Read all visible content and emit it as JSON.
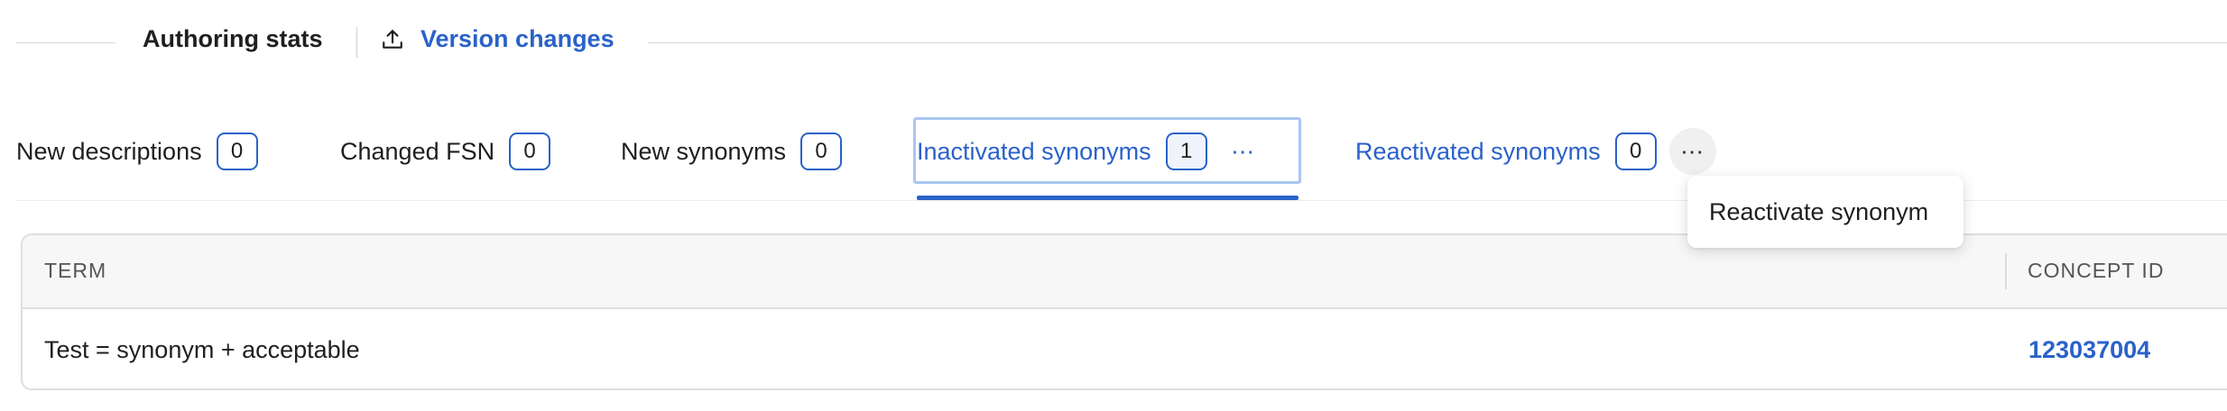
{
  "header": {
    "title": "Authoring stats",
    "version_link": "Version changes"
  },
  "tabs": [
    {
      "label": "New descriptions",
      "count": "0"
    },
    {
      "label": "Changed FSN",
      "count": "0"
    },
    {
      "label": "New synonyms",
      "count": "0"
    },
    {
      "label": "Inactivated synonyms",
      "count": "1",
      "active": true
    },
    {
      "label": "Reactivated synonyms",
      "count": "0"
    }
  ],
  "more_icon": "more-horizontal-icon",
  "menu": {
    "item": "Reactivate synonym"
  },
  "table": {
    "columns": [
      "TERM",
      "CONCEPT ID"
    ],
    "rows": [
      {
        "term": "Test = synonym + acceptable",
        "concept_id": "123037004"
      }
    ]
  },
  "colors": {
    "accent": "#2a62c9",
    "focus_ring": "#a9c6f0",
    "text": "#1f1f1f",
    "border": "#dedede"
  },
  "icons": {
    "version_link": "upload-icon",
    "tab_menu": "more-horizontal-icon"
  }
}
